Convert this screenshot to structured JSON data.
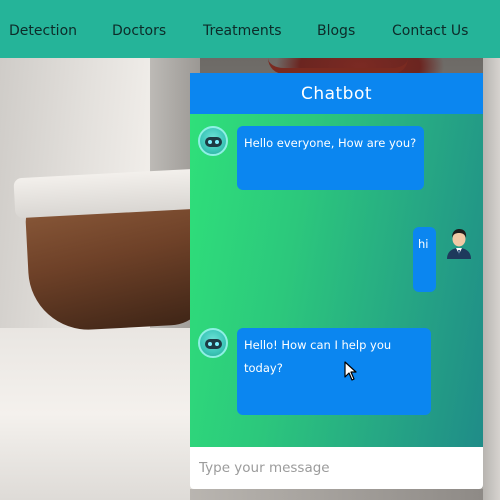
{
  "nav": {
    "items": [
      {
        "label": "Detection"
      },
      {
        "label": "Doctors"
      },
      {
        "label": "Treatments"
      },
      {
        "label": "Blogs"
      },
      {
        "label": "Contact Us"
      }
    ],
    "background_color": "#25b499"
  },
  "chatbot": {
    "title": "Chatbot",
    "header_color": "#0b86f0",
    "messages": [
      {
        "sender": "bot",
        "avatar_icon": "robot-icon",
        "text": "Hello everyone, How are you?"
      },
      {
        "sender": "user",
        "avatar_icon": "user-avatar-icon",
        "text": "hi"
      },
      {
        "sender": "bot",
        "avatar_icon": "robot-icon",
        "text": "Hello! How can I help you today?"
      }
    ],
    "input": {
      "placeholder": "Type your message",
      "value": ""
    }
  }
}
